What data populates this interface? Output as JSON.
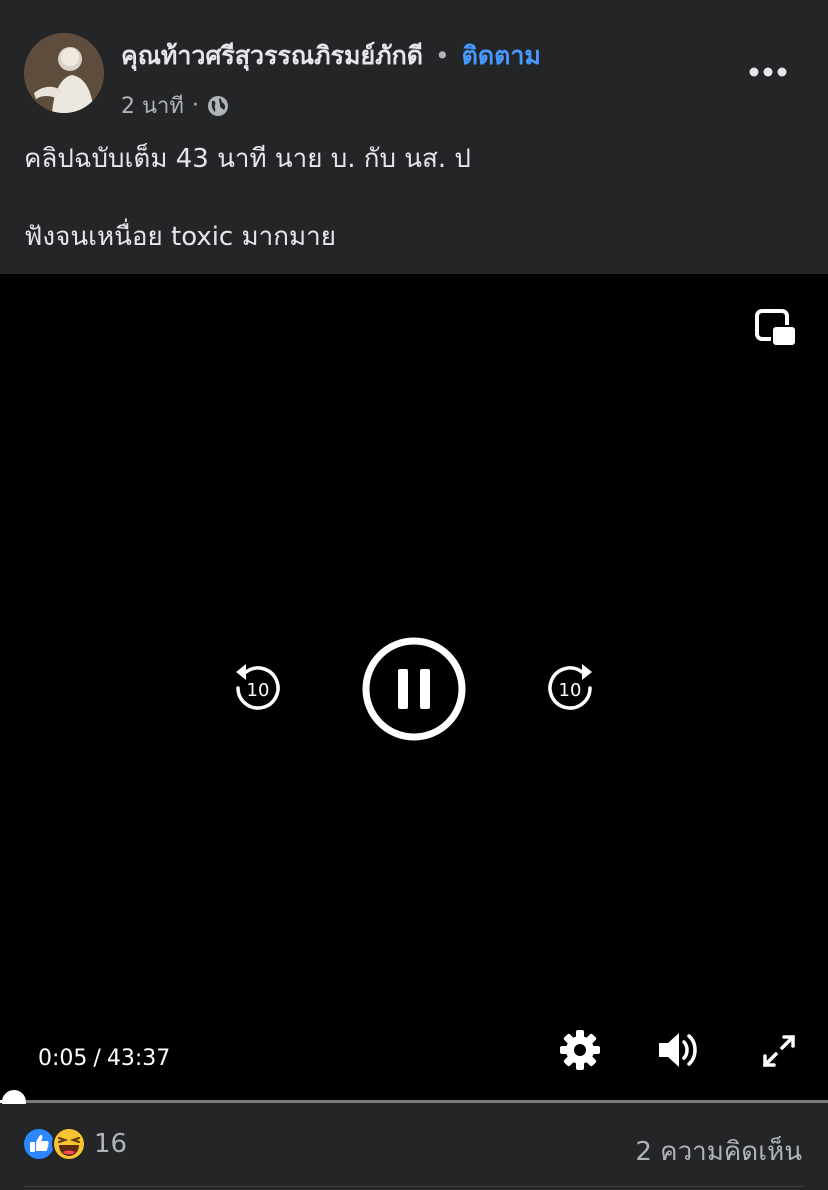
{
  "post": {
    "author": "คุณท้าวศรีสุวรรณภิรมย์ภักดี",
    "separator": "•",
    "follow_label": "ติดตาม",
    "time": "2 นาที",
    "time_separator": "·",
    "caption_line1": "คลิปฉบับเต็ม 43 นาที นาย บ. กับ นส. ป",
    "caption_line2": "ฟังจนเหนื่อย toxic มากมาย"
  },
  "video": {
    "current_time": "0:05",
    "time_separator": "/",
    "duration": "43:37",
    "skip_back_label": "10",
    "skip_forward_label": "10",
    "progress_fraction": 0.0019
  },
  "reactions": {
    "count": "16",
    "comments": "2 ความคิดเห็น"
  },
  "icons": {
    "avatar": "avatar",
    "privacy": "globe-icon",
    "more": "more-options-icon",
    "pip": "picture-in-picture-icon",
    "rewind": "rewind-10-icon",
    "pause": "pause-icon",
    "forward": "forward-10-icon",
    "settings": "gear-icon",
    "volume": "volume-icon",
    "fullscreen": "fullscreen-icon",
    "like": "like-icon",
    "haha": "haha-icon"
  },
  "colors": {
    "background": "#242526",
    "video_bg": "#000000",
    "link": "#4599ff",
    "text": "#e4e6eb",
    "muted": "#b0b3b8"
  }
}
